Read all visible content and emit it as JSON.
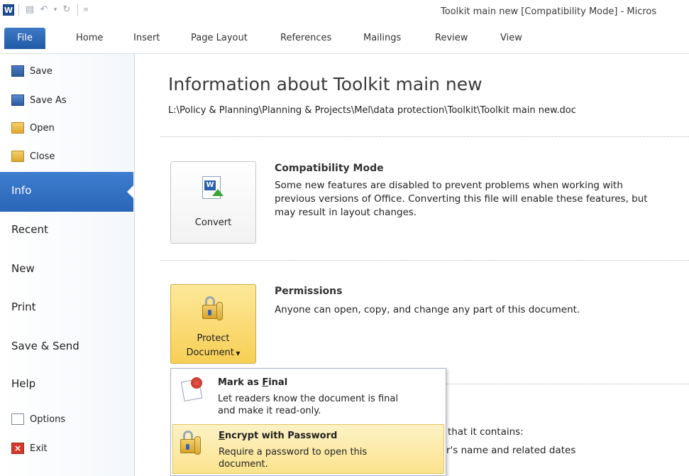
{
  "titlebar": {
    "app_icon_letter": "W",
    "window_title": "Toolkit main new [Compatibility Mode]  -  Micros"
  },
  "tabs": {
    "file": "File",
    "items": [
      "Home",
      "Insert",
      "Page Layout",
      "References",
      "Mailings",
      "Review",
      "View"
    ]
  },
  "leftnav": {
    "save": "Save",
    "save_as": "Save As",
    "open": "Open",
    "close": "Close",
    "info": "Info",
    "recent": "Recent",
    "new": "New",
    "print": "Print",
    "save_send": "Save & Send",
    "help": "Help",
    "options": "Options",
    "exit": "Exit"
  },
  "main": {
    "title": "Information about Toolkit main new",
    "path": "L:\\Policy & Planning\\Planning & Projects\\Mel\\data protection\\Toolkit\\Toolkit main new.doc",
    "convert_button": "Convert",
    "compat_heading": "Compatibility Mode",
    "compat_line1": "Some new features are disabled to prevent problems when working with",
    "compat_line2": "previous versions of Office. Converting this file will enable these features, but",
    "compat_line3": "may result in layout changes.",
    "protect_line1": "Protect",
    "protect_line2": "Document",
    "permissions_heading": "Permissions",
    "permissions_text": "Anyone can open, copy, and change any part of this document.",
    "behind_text1": "that it contains:",
    "behind_text2": "r's name and related dates"
  },
  "dropdown": {
    "mark_final_prefix": "Mark as ",
    "mark_final_underlined": "F",
    "mark_final_suffix": "inal",
    "mark_final_line1": "Let readers know the document is final",
    "mark_final_line2": "and make it read-only.",
    "encrypt_underlined": "E",
    "encrypt_suffix": "ncrypt with Password",
    "encrypt_line1": "Require a password to open this",
    "encrypt_line2": "document."
  }
}
